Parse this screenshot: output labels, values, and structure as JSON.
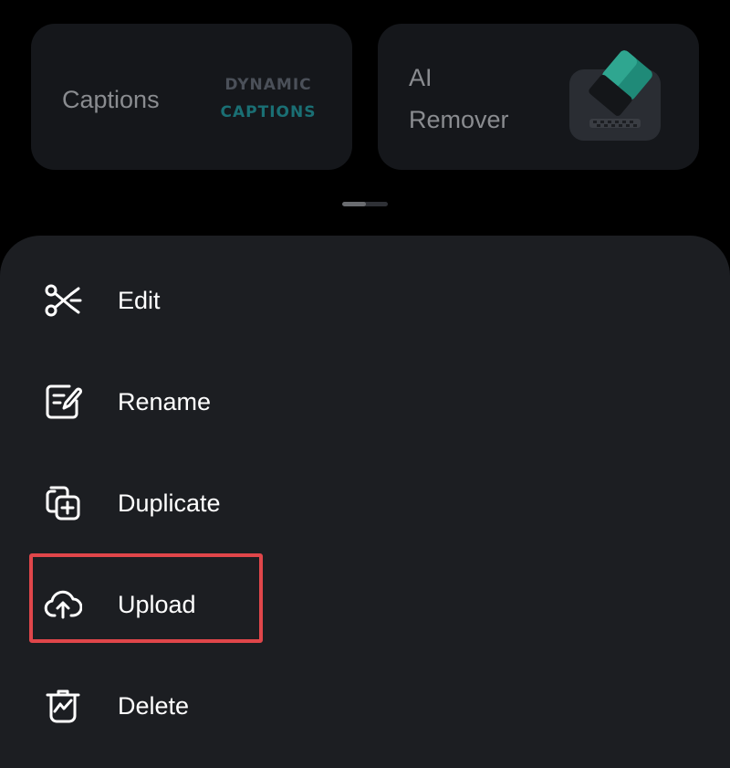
{
  "feature_cards": [
    {
      "label": "Captions",
      "thumb_line1": "DYNAMIC",
      "thumb_line2": "CAPTIONS",
      "icon": "dynamic-captions-icon"
    },
    {
      "label": "AI\nRemover",
      "icon": "eraser-icon"
    }
  ],
  "menu": {
    "items": [
      {
        "label": "Edit",
        "icon": "scissors-icon"
      },
      {
        "label": "Rename",
        "icon": "rename-icon"
      },
      {
        "label": "Duplicate",
        "icon": "duplicate-icon"
      },
      {
        "label": "Upload",
        "icon": "cloud-upload-icon"
      },
      {
        "label": "Delete",
        "icon": "trash-icon"
      }
    ],
    "highlighted_item": "Upload"
  },
  "colors": {
    "background": "#000000",
    "card": "#15171b",
    "sheet": "#1c1e22",
    "highlight": "#e0464a",
    "text": "#ffffff",
    "card_text": "#8a8c90"
  }
}
